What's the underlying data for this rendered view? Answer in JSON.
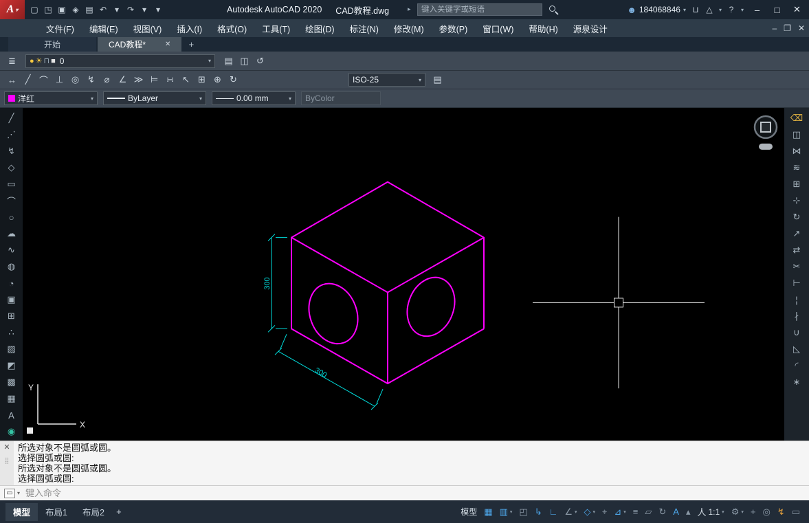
{
  "ui": {
    "caret": "▾"
  },
  "titlebar": {
    "logo_letter": "A",
    "logo_caret": "▾",
    "app_title": "Autodesk AutoCAD 2020",
    "doc_title": "CAD教程.dwg",
    "keytip": "▸",
    "search_placeholder": "键入关键字或短语",
    "user_icon_glyph": "☻",
    "username": "184068846",
    "account_caret": "▾",
    "store_icon_glyph": "⊔",
    "apps_icon_glyph": "△",
    "apps_caret": "▾",
    "help_icon_glyph": "?",
    "help_caret": "▾",
    "qat_icons": [
      {
        "name": "new-drawing-icon",
        "glyph": "▢"
      },
      {
        "name": "open-drawing-icon",
        "glyph": "◳"
      },
      {
        "name": "save-icon",
        "glyph": "▣"
      },
      {
        "name": "save-as-icon",
        "glyph": "◈"
      },
      {
        "name": "plot-icon",
        "glyph": "▤"
      },
      {
        "name": "undo-icon",
        "glyph": "↶"
      },
      {
        "name": "undo-caret-icon",
        "glyph": "▾"
      },
      {
        "name": "redo-icon",
        "glyph": "↷"
      },
      {
        "name": "redo-caret-icon",
        "glyph": "▾"
      },
      {
        "name": "qat-customize-icon",
        "glyph": "▾"
      }
    ],
    "window": {
      "minimize": "–",
      "maximize": "□",
      "close": "✕"
    }
  },
  "menubar": {
    "items": [
      "文件(F)",
      "编辑(E)",
      "视图(V)",
      "插入(I)",
      "格式(O)",
      "工具(T)",
      "绘图(D)",
      "标注(N)",
      "修改(M)",
      "参数(P)",
      "窗口(W)",
      "帮助(H)",
      "源泉设计"
    ],
    "window": {
      "minimize": "–",
      "restore": "❐",
      "close": "✕"
    }
  },
  "file_tabs": {
    "start": "开始",
    "doc": "CAD教程*",
    "close": "✕",
    "new_tab": "+"
  },
  "layer_toolbar": {
    "manager_icon_glyph": "≣",
    "current_layer": "0",
    "status_icons": [
      {
        "name": "layer-on-bulb-icon",
        "glyph": "●",
        "color": "#f5c842"
      },
      {
        "name": "layer-thaw-sun-icon",
        "glyph": "☀",
        "color": "#f5c842"
      },
      {
        "name": "layer-lock-icon",
        "glyph": "⊓",
        "color": "#9fb0bd"
      },
      {
        "name": "layer-color-swatch",
        "glyph": "■",
        "color": "#e6e6e6"
      }
    ],
    "trailing_icons": [
      {
        "name": "layer-properties-icon",
        "glyph": "▤"
      },
      {
        "name": "layer-match-icon",
        "glyph": "◫"
      },
      {
        "name": "layer-previous-icon",
        "glyph": "↺"
      }
    ]
  },
  "dim_toolbar": {
    "icons": [
      {
        "name": "dim-linear-icon",
        "glyph": "↔"
      },
      {
        "name": "dim-aligned-icon",
        "glyph": "╱"
      },
      {
        "name": "dim-arc-length-icon",
        "glyph": "⌒"
      },
      {
        "name": "dim-ordinate-icon",
        "glyph": "⊥"
      },
      {
        "name": "dim-radius-icon",
        "glyph": "◎"
      },
      {
        "name": "dim-jogged-icon",
        "glyph": "↯"
      },
      {
        "name": "dim-diameter-icon",
        "glyph": "⌀"
      },
      {
        "name": "dim-angular-icon",
        "glyph": "∠"
      },
      {
        "name": "quick-dim-icon",
        "glyph": "≫"
      },
      {
        "name": "dim-baseline-icon",
        "glyph": "⊨"
      },
      {
        "name": "dim-continue-icon",
        "glyph": "∺"
      },
      {
        "name": "quick-leader-icon",
        "glyph": "↖"
      },
      {
        "name": "tolerance-icon",
        "glyph": "⊞"
      },
      {
        "name": "center-mark-icon",
        "glyph": "⊕"
      },
      {
        "name": "dim-update-icon",
        "glyph": "↻"
      }
    ],
    "style_value": "ISO-25",
    "trailing_icon_glyph": "▤"
  },
  "properties_toolbar": {
    "color_label": "洋红",
    "color_hex": "#ff00ff",
    "linetype_label": "ByLayer",
    "lineweight_label": "0.00 mm",
    "plot_style_label": "ByColor"
  },
  "draw_toolbar": {
    "icons": [
      {
        "name": "line-tool-icon",
        "glyph": "╱"
      },
      {
        "name": "construction-line-tool-icon",
        "glyph": "⋰"
      },
      {
        "name": "polyline-tool-icon",
        "glyph": "↯"
      },
      {
        "name": "polygon-tool-icon",
        "glyph": "◇"
      },
      {
        "name": "rectangle-tool-icon",
        "glyph": "▭"
      },
      {
        "name": "arc-tool-icon",
        "glyph": "⌒"
      },
      {
        "name": "circle-tool-icon",
        "glyph": "○"
      },
      {
        "name": "revision-cloud-tool-icon",
        "glyph": "☁"
      },
      {
        "name": "spline-tool-icon",
        "glyph": "∿"
      },
      {
        "name": "ellipse-tool-icon",
        "glyph": "◍"
      },
      {
        "name": "ellipse-arc-tool-icon",
        "glyph": "◔"
      },
      {
        "name": "insert-block-tool-icon",
        "glyph": "▣"
      },
      {
        "name": "make-block-tool-icon",
        "glyph": "⊞"
      },
      {
        "name": "point-tool-icon",
        "glyph": "∴"
      },
      {
        "name": "hatch-tool-icon",
        "glyph": "▨"
      },
      {
        "name": "gradient-tool-icon",
        "glyph": "◩"
      },
      {
        "name": "region-tool-icon",
        "glyph": "▩"
      },
      {
        "name": "table-tool-icon",
        "glyph": "▦"
      },
      {
        "name": "mtext-tool-icon",
        "glyph": "A"
      },
      {
        "name": "point-style-tool-icon",
        "glyph": "◉",
        "color": "#35c4a5"
      }
    ]
  },
  "modify_toolbar": {
    "icons": [
      {
        "name": "erase-tool-icon",
        "glyph": "⌫",
        "color": "#e3b341"
      },
      {
        "name": "copy-tool-icon",
        "glyph": "◫"
      },
      {
        "name": "mirror-tool-icon",
        "glyph": "⋈"
      },
      {
        "name": "offset-tool-icon",
        "glyph": "≋"
      },
      {
        "name": "array-tool-icon",
        "glyph": "⊞"
      },
      {
        "name": "move-tool-icon",
        "glyph": "⊹"
      },
      {
        "name": "rotate-tool-icon",
        "glyph": "↻"
      },
      {
        "name": "scale-tool-icon",
        "glyph": "↗"
      },
      {
        "name": "stretch-tool-icon",
        "glyph": "⇄"
      },
      {
        "name": "trim-tool-icon",
        "glyph": "✂"
      },
      {
        "name": "extend-tool-icon",
        "glyph": "⊢"
      },
      {
        "name": "break-at-point-tool-icon",
        "glyph": "¦"
      },
      {
        "name": "break-tool-icon",
        "glyph": "∤"
      },
      {
        "name": "join-tool-icon",
        "glyph": "∪"
      },
      {
        "name": "chamfer-tool-icon",
        "glyph": "◺"
      },
      {
        "name": "fillet-tool-icon",
        "glyph": "◜"
      },
      {
        "name": "explode-tool-icon",
        "glyph": "∗"
      }
    ]
  },
  "canvas": {
    "dim_vertical": "300",
    "dim_horizontal": "300",
    "ucs_x_label": "X",
    "ucs_y_label": "Y",
    "cube_color": "#ff00ff",
    "dimension_color": "#00dcdc"
  },
  "command": {
    "close": "✕",
    "grip": "⣿",
    "macro_icon": "▭",
    "history": [
      "所选对象不是圆弧或圆。",
      "选择圆弧或圆:",
      "所选对象不是圆弧或圆。",
      "选择圆弧或圆:"
    ],
    "prompt": "键入命令"
  },
  "statusbar": {
    "layout_tabs": [
      {
        "label": "模型",
        "active": true
      },
      {
        "label": "布局1"
      },
      {
        "label": "布局2"
      }
    ],
    "new_layout": "+",
    "right_items": [
      {
        "name": "model-paper-toggle",
        "label": "模型"
      },
      {
        "name": "grid-display-icon",
        "glyph": "▦",
        "color": "#4da6e8"
      },
      {
        "name": "snap-mode-icon",
        "glyph": "▥",
        "arrow": "▾",
        "color": "#4da6e8"
      },
      {
        "name": "infer-constraints-icon",
        "glyph": "◰"
      },
      {
        "name": "dynamic-input-icon",
        "glyph": "↳",
        "color": "#4da6e8"
      },
      {
        "name": "ortho-mode-icon",
        "glyph": "∟",
        "color": "#4da6e8"
      },
      {
        "name": "polar-tracking-icon",
        "glyph": "∠",
        "arrow": "▾"
      },
      {
        "name": "isometric-drafting-icon",
        "glyph": "◇",
        "arrow": "▾",
        "color": "#4da6e8"
      },
      {
        "name": "object-snap-tracking-icon",
        "glyph": "⌖"
      },
      {
        "name": "object-snap-icon",
        "glyph": "⊿",
        "arrow": "▾",
        "color": "#4da6e8"
      },
      {
        "name": "lineweight-icon",
        "glyph": "≡"
      },
      {
        "name": "transparency-icon",
        "glyph": "▱"
      },
      {
        "name": "selection-cycling-icon",
        "glyph": "↻"
      },
      {
        "name": "annotation-visibility-icon",
        "glyph": "A",
        "color": "#4da6e8"
      },
      {
        "name": "autoscale-icon",
        "glyph": "▴"
      },
      {
        "name": "annotation-scale-button",
        "glyph": "人",
        "label": "1:1",
        "arrow": "▾",
        "color": "#d0d9e2"
      },
      {
        "name": "workspace-switching-icon",
        "glyph": "⚙",
        "arrow": "▾"
      },
      {
        "name": "annotation-monitor-icon",
        "glyph": "+"
      },
      {
        "name": "isolate-objects-icon",
        "glyph": "◎"
      },
      {
        "name": "graphics-performance-icon",
        "glyph": "↯",
        "color": "#e8a33d"
      },
      {
        "name": "clean-screen-icon",
        "glyph": "▭"
      }
    ]
  }
}
